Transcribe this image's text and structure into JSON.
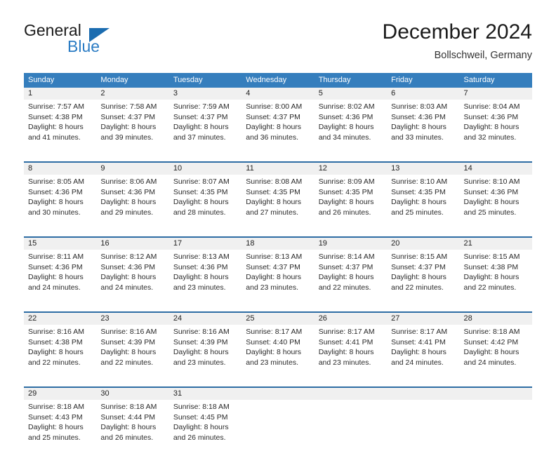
{
  "brand": {
    "name_top": "General",
    "name_bottom": "Blue",
    "triangle_icon": "blue-triangle-icon",
    "accent_color": "#2b7cc4"
  },
  "header": {
    "title": "December 2024",
    "subtitle": "Bollschweil, Germany"
  },
  "colors": {
    "header_blue": "#357ebd",
    "row_divider_blue": "#2e6da4",
    "numrow_gray": "#f0f0f0",
    "text": "#2a2a2a"
  },
  "calendar": {
    "day_names": [
      "Sunday",
      "Monday",
      "Tuesday",
      "Wednesday",
      "Thursday",
      "Friday",
      "Saturday"
    ],
    "weeks": [
      {
        "days": [
          {
            "num": "1",
            "sunrise": "Sunrise: 7:57 AM",
            "sunset": "Sunset: 4:38 PM",
            "daylight1": "Daylight: 8 hours",
            "daylight2": "and 41 minutes."
          },
          {
            "num": "2",
            "sunrise": "Sunrise: 7:58 AM",
            "sunset": "Sunset: 4:37 PM",
            "daylight1": "Daylight: 8 hours",
            "daylight2": "and 39 minutes."
          },
          {
            "num": "3",
            "sunrise": "Sunrise: 7:59 AM",
            "sunset": "Sunset: 4:37 PM",
            "daylight1": "Daylight: 8 hours",
            "daylight2": "and 37 minutes."
          },
          {
            "num": "4",
            "sunrise": "Sunrise: 8:00 AM",
            "sunset": "Sunset: 4:37 PM",
            "daylight1": "Daylight: 8 hours",
            "daylight2": "and 36 minutes."
          },
          {
            "num": "5",
            "sunrise": "Sunrise: 8:02 AM",
            "sunset": "Sunset: 4:36 PM",
            "daylight1": "Daylight: 8 hours",
            "daylight2": "and 34 minutes."
          },
          {
            "num": "6",
            "sunrise": "Sunrise: 8:03 AM",
            "sunset": "Sunset: 4:36 PM",
            "daylight1": "Daylight: 8 hours",
            "daylight2": "and 33 minutes."
          },
          {
            "num": "7",
            "sunrise": "Sunrise: 8:04 AM",
            "sunset": "Sunset: 4:36 PM",
            "daylight1": "Daylight: 8 hours",
            "daylight2": "and 32 minutes."
          }
        ]
      },
      {
        "days": [
          {
            "num": "8",
            "sunrise": "Sunrise: 8:05 AM",
            "sunset": "Sunset: 4:36 PM",
            "daylight1": "Daylight: 8 hours",
            "daylight2": "and 30 minutes."
          },
          {
            "num": "9",
            "sunrise": "Sunrise: 8:06 AM",
            "sunset": "Sunset: 4:36 PM",
            "daylight1": "Daylight: 8 hours",
            "daylight2": "and 29 minutes."
          },
          {
            "num": "10",
            "sunrise": "Sunrise: 8:07 AM",
            "sunset": "Sunset: 4:35 PM",
            "daylight1": "Daylight: 8 hours",
            "daylight2": "and 28 minutes."
          },
          {
            "num": "11",
            "sunrise": "Sunrise: 8:08 AM",
            "sunset": "Sunset: 4:35 PM",
            "daylight1": "Daylight: 8 hours",
            "daylight2": "and 27 minutes."
          },
          {
            "num": "12",
            "sunrise": "Sunrise: 8:09 AM",
            "sunset": "Sunset: 4:35 PM",
            "daylight1": "Daylight: 8 hours",
            "daylight2": "and 26 minutes."
          },
          {
            "num": "13",
            "sunrise": "Sunrise: 8:10 AM",
            "sunset": "Sunset: 4:35 PM",
            "daylight1": "Daylight: 8 hours",
            "daylight2": "and 25 minutes."
          },
          {
            "num": "14",
            "sunrise": "Sunrise: 8:10 AM",
            "sunset": "Sunset: 4:36 PM",
            "daylight1": "Daylight: 8 hours",
            "daylight2": "and 25 minutes."
          }
        ]
      },
      {
        "days": [
          {
            "num": "15",
            "sunrise": "Sunrise: 8:11 AM",
            "sunset": "Sunset: 4:36 PM",
            "daylight1": "Daylight: 8 hours",
            "daylight2": "and 24 minutes."
          },
          {
            "num": "16",
            "sunrise": "Sunrise: 8:12 AM",
            "sunset": "Sunset: 4:36 PM",
            "daylight1": "Daylight: 8 hours",
            "daylight2": "and 24 minutes."
          },
          {
            "num": "17",
            "sunrise": "Sunrise: 8:13 AM",
            "sunset": "Sunset: 4:36 PM",
            "daylight1": "Daylight: 8 hours",
            "daylight2": "and 23 minutes."
          },
          {
            "num": "18",
            "sunrise": "Sunrise: 8:13 AM",
            "sunset": "Sunset: 4:37 PM",
            "daylight1": "Daylight: 8 hours",
            "daylight2": "and 23 minutes."
          },
          {
            "num": "19",
            "sunrise": "Sunrise: 8:14 AM",
            "sunset": "Sunset: 4:37 PM",
            "daylight1": "Daylight: 8 hours",
            "daylight2": "and 22 minutes."
          },
          {
            "num": "20",
            "sunrise": "Sunrise: 8:15 AM",
            "sunset": "Sunset: 4:37 PM",
            "daylight1": "Daylight: 8 hours",
            "daylight2": "and 22 minutes."
          },
          {
            "num": "21",
            "sunrise": "Sunrise: 8:15 AM",
            "sunset": "Sunset: 4:38 PM",
            "daylight1": "Daylight: 8 hours",
            "daylight2": "and 22 minutes."
          }
        ]
      },
      {
        "days": [
          {
            "num": "22",
            "sunrise": "Sunrise: 8:16 AM",
            "sunset": "Sunset: 4:38 PM",
            "daylight1": "Daylight: 8 hours",
            "daylight2": "and 22 minutes."
          },
          {
            "num": "23",
            "sunrise": "Sunrise: 8:16 AM",
            "sunset": "Sunset: 4:39 PM",
            "daylight1": "Daylight: 8 hours",
            "daylight2": "and 22 minutes."
          },
          {
            "num": "24",
            "sunrise": "Sunrise: 8:16 AM",
            "sunset": "Sunset: 4:39 PM",
            "daylight1": "Daylight: 8 hours",
            "daylight2": "and 23 minutes."
          },
          {
            "num": "25",
            "sunrise": "Sunrise: 8:17 AM",
            "sunset": "Sunset: 4:40 PM",
            "daylight1": "Daylight: 8 hours",
            "daylight2": "and 23 minutes."
          },
          {
            "num": "26",
            "sunrise": "Sunrise: 8:17 AM",
            "sunset": "Sunset: 4:41 PM",
            "daylight1": "Daylight: 8 hours",
            "daylight2": "and 23 minutes."
          },
          {
            "num": "27",
            "sunrise": "Sunrise: 8:17 AM",
            "sunset": "Sunset: 4:41 PM",
            "daylight1": "Daylight: 8 hours",
            "daylight2": "and 24 minutes."
          },
          {
            "num": "28",
            "sunrise": "Sunrise: 8:18 AM",
            "sunset": "Sunset: 4:42 PM",
            "daylight1": "Daylight: 8 hours",
            "daylight2": "and 24 minutes."
          }
        ]
      },
      {
        "days": [
          {
            "num": "29",
            "sunrise": "Sunrise: 8:18 AM",
            "sunset": "Sunset: 4:43 PM",
            "daylight1": "Daylight: 8 hours",
            "daylight2": "and 25 minutes."
          },
          {
            "num": "30",
            "sunrise": "Sunrise: 8:18 AM",
            "sunset": "Sunset: 4:44 PM",
            "daylight1": "Daylight: 8 hours",
            "daylight2": "and 26 minutes."
          },
          {
            "num": "31",
            "sunrise": "Sunrise: 8:18 AM",
            "sunset": "Sunset: 4:45 PM",
            "daylight1": "Daylight: 8 hours",
            "daylight2": "and 26 minutes."
          },
          {
            "num": "",
            "sunrise": "",
            "sunset": "",
            "daylight1": "",
            "daylight2": ""
          },
          {
            "num": "",
            "sunrise": "",
            "sunset": "",
            "daylight1": "",
            "daylight2": ""
          },
          {
            "num": "",
            "sunrise": "",
            "sunset": "",
            "daylight1": "",
            "daylight2": ""
          },
          {
            "num": "",
            "sunrise": "",
            "sunset": "",
            "daylight1": "",
            "daylight2": ""
          }
        ]
      }
    ]
  }
}
